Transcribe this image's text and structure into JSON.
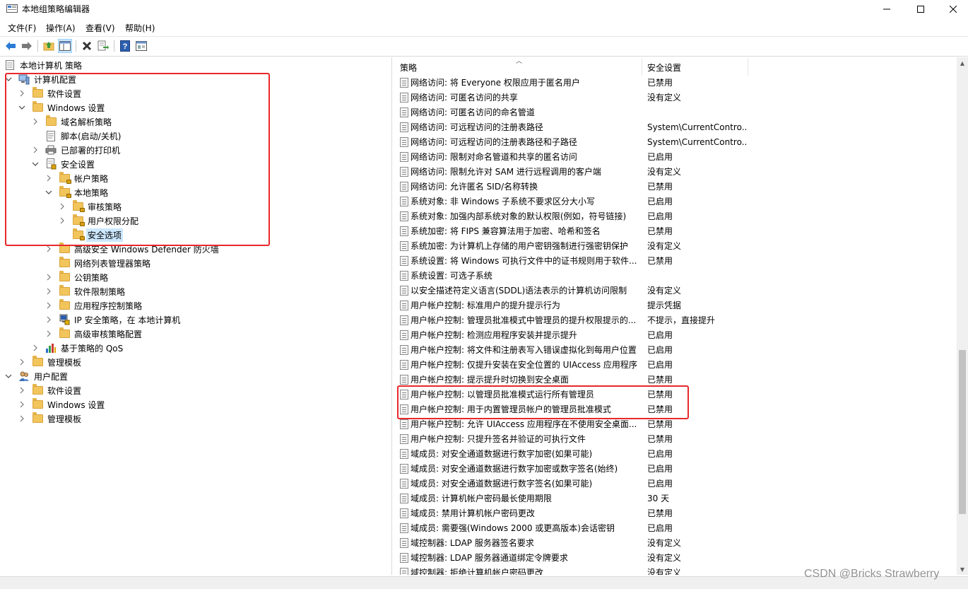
{
  "window": {
    "title": "本地组策略编辑器"
  },
  "menu": [
    "文件(F)",
    "操作(A)",
    "查看(V)",
    "帮助(H)"
  ],
  "toolbar": {
    "buttons": [
      "back-icon",
      "forward-icon",
      "up-folder-icon",
      "show-hide-tree-icon",
      "delete-icon",
      "export-list-icon",
      "help-icon",
      "properties-icon"
    ]
  },
  "tree": {
    "root": "本地计算机 策略",
    "items": [
      {
        "label": "计算机配置",
        "level": 0,
        "expand": "open",
        "icon": "computer-icon"
      },
      {
        "label": "软件设置",
        "level": 1,
        "expand": "closed",
        "icon": "folder-icon"
      },
      {
        "label": "Windows 设置",
        "level": 1,
        "expand": "open",
        "icon": "folder-icon"
      },
      {
        "label": "域名解析策略",
        "level": 2,
        "expand": "closed",
        "icon": "folder-icon"
      },
      {
        "label": "脚本(启动/关机)",
        "level": 2,
        "expand": "none",
        "icon": "script-icon"
      },
      {
        "label": "已部署的打印机",
        "level": 2,
        "expand": "closed",
        "icon": "printer-icon"
      },
      {
        "label": "安全设置",
        "level": 2,
        "expand": "open",
        "icon": "security-settings-icon"
      },
      {
        "label": "帐户策略",
        "level": 3,
        "expand": "closed",
        "icon": "locked-folder-icon"
      },
      {
        "label": "本地策略",
        "level": 3,
        "expand": "open",
        "icon": "locked-folder-icon"
      },
      {
        "label": "审核策略",
        "level": 4,
        "expand": "closed",
        "icon": "locked-folder-icon"
      },
      {
        "label": "用户权限分配",
        "level": 4,
        "expand": "closed",
        "icon": "locked-folder-icon"
      },
      {
        "label": "安全选项",
        "level": 4,
        "expand": "none",
        "icon": "locked-folder-icon",
        "selected": true
      },
      {
        "label": "高级安全 Windows Defender 防火墙",
        "level": 3,
        "expand": "closed",
        "icon": "folder-icon"
      },
      {
        "label": "网络列表管理器策略",
        "level": 3,
        "expand": "none",
        "icon": "folder-icon"
      },
      {
        "label": "公钥策略",
        "level": 3,
        "expand": "closed",
        "icon": "folder-icon"
      },
      {
        "label": "软件限制策略",
        "level": 3,
        "expand": "closed",
        "icon": "folder-icon"
      },
      {
        "label": "应用程序控制策略",
        "level": 3,
        "expand": "closed",
        "icon": "folder-icon"
      },
      {
        "label": "IP 安全策略，在 本地计算机",
        "level": 3,
        "expand": "closed",
        "icon": "ip-security-icon"
      },
      {
        "label": "高级审核策略配置",
        "level": 3,
        "expand": "closed",
        "icon": "folder-icon"
      },
      {
        "label": "基于策略的 QoS",
        "level": 2,
        "expand": "closed",
        "icon": "qos-chart-icon"
      },
      {
        "label": "管理模板",
        "level": 1,
        "expand": "closed",
        "icon": "folder-icon"
      },
      {
        "label": "用户配置",
        "level": 0,
        "expand": "open",
        "icon": "user-icon"
      },
      {
        "label": "软件设置",
        "level": 1,
        "expand": "closed",
        "icon": "folder-icon"
      },
      {
        "label": "Windows 设置",
        "level": 1,
        "expand": "closed",
        "icon": "folder-icon"
      },
      {
        "label": "管理模板",
        "level": 1,
        "expand": "closed",
        "icon": "folder-icon"
      }
    ]
  },
  "list": {
    "columns": [
      "策略",
      "安全设置"
    ],
    "rows": [
      {
        "policy": "网络访问: 将 Everyone 权限应用于匿名用户",
        "setting": "已禁用"
      },
      {
        "policy": "网络访问: 可匿名访问的共享",
        "setting": "没有定义"
      },
      {
        "policy": "网络访问: 可匿名访问的命名管道",
        "setting": ""
      },
      {
        "policy": "网络访问: 可远程访问的注册表路径",
        "setting": "System\\CurrentContro..."
      },
      {
        "policy": "网络访问: 可远程访问的注册表路径和子路径",
        "setting": "System\\CurrentContro..."
      },
      {
        "policy": "网络访问: 限制对命名管道和共享的匿名访问",
        "setting": "已启用"
      },
      {
        "policy": "网络访问: 限制允许对 SAM 进行远程调用的客户端",
        "setting": "没有定义"
      },
      {
        "policy": "网络访问: 允许匿名 SID/名称转换",
        "setting": "已禁用"
      },
      {
        "policy": "系统对象: 非 Windows 子系统不要求区分大小写",
        "setting": "已启用"
      },
      {
        "policy": "系统对象: 加强内部系统对象的默认权限(例如，符号链接)",
        "setting": "已启用"
      },
      {
        "policy": "系统加密: 将 FIPS 兼容算法用于加密、哈希和签名",
        "setting": "已禁用"
      },
      {
        "policy": "系统加密: 为计算机上存储的用户密钥强制进行强密钥保护",
        "setting": "没有定义"
      },
      {
        "policy": "系统设置: 将 Windows 可执行文件中的证书规则用于软件...",
        "setting": "已禁用"
      },
      {
        "policy": "系统设置: 可选子系统",
        "setting": ""
      },
      {
        "policy": "以安全描述符定义语言(SDDL)语法表示的计算机访问限制",
        "setting": "没有定义"
      },
      {
        "policy": "用户帐户控制: 标准用户的提升提示行为",
        "setting": "提示凭据"
      },
      {
        "policy": "用户帐户控制: 管理员批准模式中管理员的提升权限提示的...",
        "setting": "不提示，直接提升"
      },
      {
        "policy": "用户帐户控制: 检测应用程序安装并提示提升",
        "setting": "已启用"
      },
      {
        "policy": "用户帐户控制: 将文件和注册表写入错误虚拟化到每用户位置",
        "setting": "已启用"
      },
      {
        "policy": "用户帐户控制: 仅提升安装在安全位置的 UIAccess 应用程序",
        "setting": "已启用"
      },
      {
        "policy": "用户帐户控制: 提示提升时切换到安全桌面",
        "setting": "已禁用"
      },
      {
        "policy": "用户帐户控制: 以管理员批准模式运行所有管理员",
        "setting": "已禁用"
      },
      {
        "policy": "用户帐户控制: 用于内置管理员帐户的管理员批准模式",
        "setting": "已禁用"
      },
      {
        "policy": "用户帐户控制: 允许 UIAccess 应用程序在不使用安全桌面...",
        "setting": "已禁用"
      },
      {
        "policy": "用户帐户控制: 只提升签名并验证的可执行文件",
        "setting": "已禁用"
      },
      {
        "policy": "域成员: 对安全通道数据进行数字加密(如果可能)",
        "setting": "已启用"
      },
      {
        "policy": "域成员: 对安全通道数据进行数字加密或数字签名(始终)",
        "setting": "已启用"
      },
      {
        "policy": "域成员: 对安全通道数据进行数字签名(如果可能)",
        "setting": "已启用"
      },
      {
        "policy": "域成员: 计算机帐户密码最长使用期限",
        "setting": "30 天"
      },
      {
        "policy": "域成员: 禁用计算机帐户密码更改",
        "setting": "已禁用"
      },
      {
        "policy": "域成员: 需要强(Windows 2000 或更高版本)会话密钥",
        "setting": "已启用"
      },
      {
        "policy": "域控制器: LDAP 服务器签名要求",
        "setting": "没有定义"
      },
      {
        "policy": "域控制器: LDAP 服务器通道绑定令牌要求",
        "setting": "没有定义"
      },
      {
        "policy": "域控制器: 拒绝计算机帐户密码更改",
        "setting": "没有定义"
      }
    ]
  },
  "watermark": "CSDN @Bricks Strawberry",
  "colors": {
    "highlight": "#e8282b",
    "selection": "#cce8ff"
  }
}
